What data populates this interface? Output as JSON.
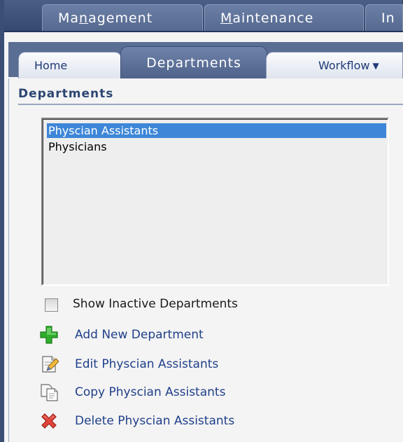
{
  "top_tabs": [
    {
      "label_pre": "Ma",
      "label_ul": "n",
      "label_post": "agement"
    },
    {
      "label_pre": "",
      "label_ul": "M",
      "label_post": "aintenance"
    },
    {
      "label_pre": "In",
      "label_ul": "",
      "label_post": ""
    }
  ],
  "sub_tabs": {
    "home": "Home",
    "departments": "Departments",
    "workflow": "Workflow"
  },
  "panel": {
    "title": "Departments"
  },
  "departments_list": [
    {
      "label": "Physcian Assistants",
      "selected": true
    },
    {
      "label": "Physicians",
      "selected": false
    }
  ],
  "show_inactive": {
    "label": "Show Inactive Departments",
    "checked": false
  },
  "actions": {
    "add": {
      "label": "Add New Department",
      "icon": "plus-icon"
    },
    "edit": {
      "label": "Edit Physcian Assistants",
      "icon": "edit-icon"
    },
    "copy": {
      "label": "Copy Physcian Assistants",
      "icon": "copy-icon"
    },
    "delete": {
      "label": "Delete Physcian Assistants",
      "icon": "delete-icon"
    }
  },
  "colors": {
    "nav_dark": "#4a5f86",
    "selection": "#3d86d8",
    "link": "#1f3f8a",
    "add_green": "#2fae2a",
    "delete_red": "#e0443a"
  }
}
